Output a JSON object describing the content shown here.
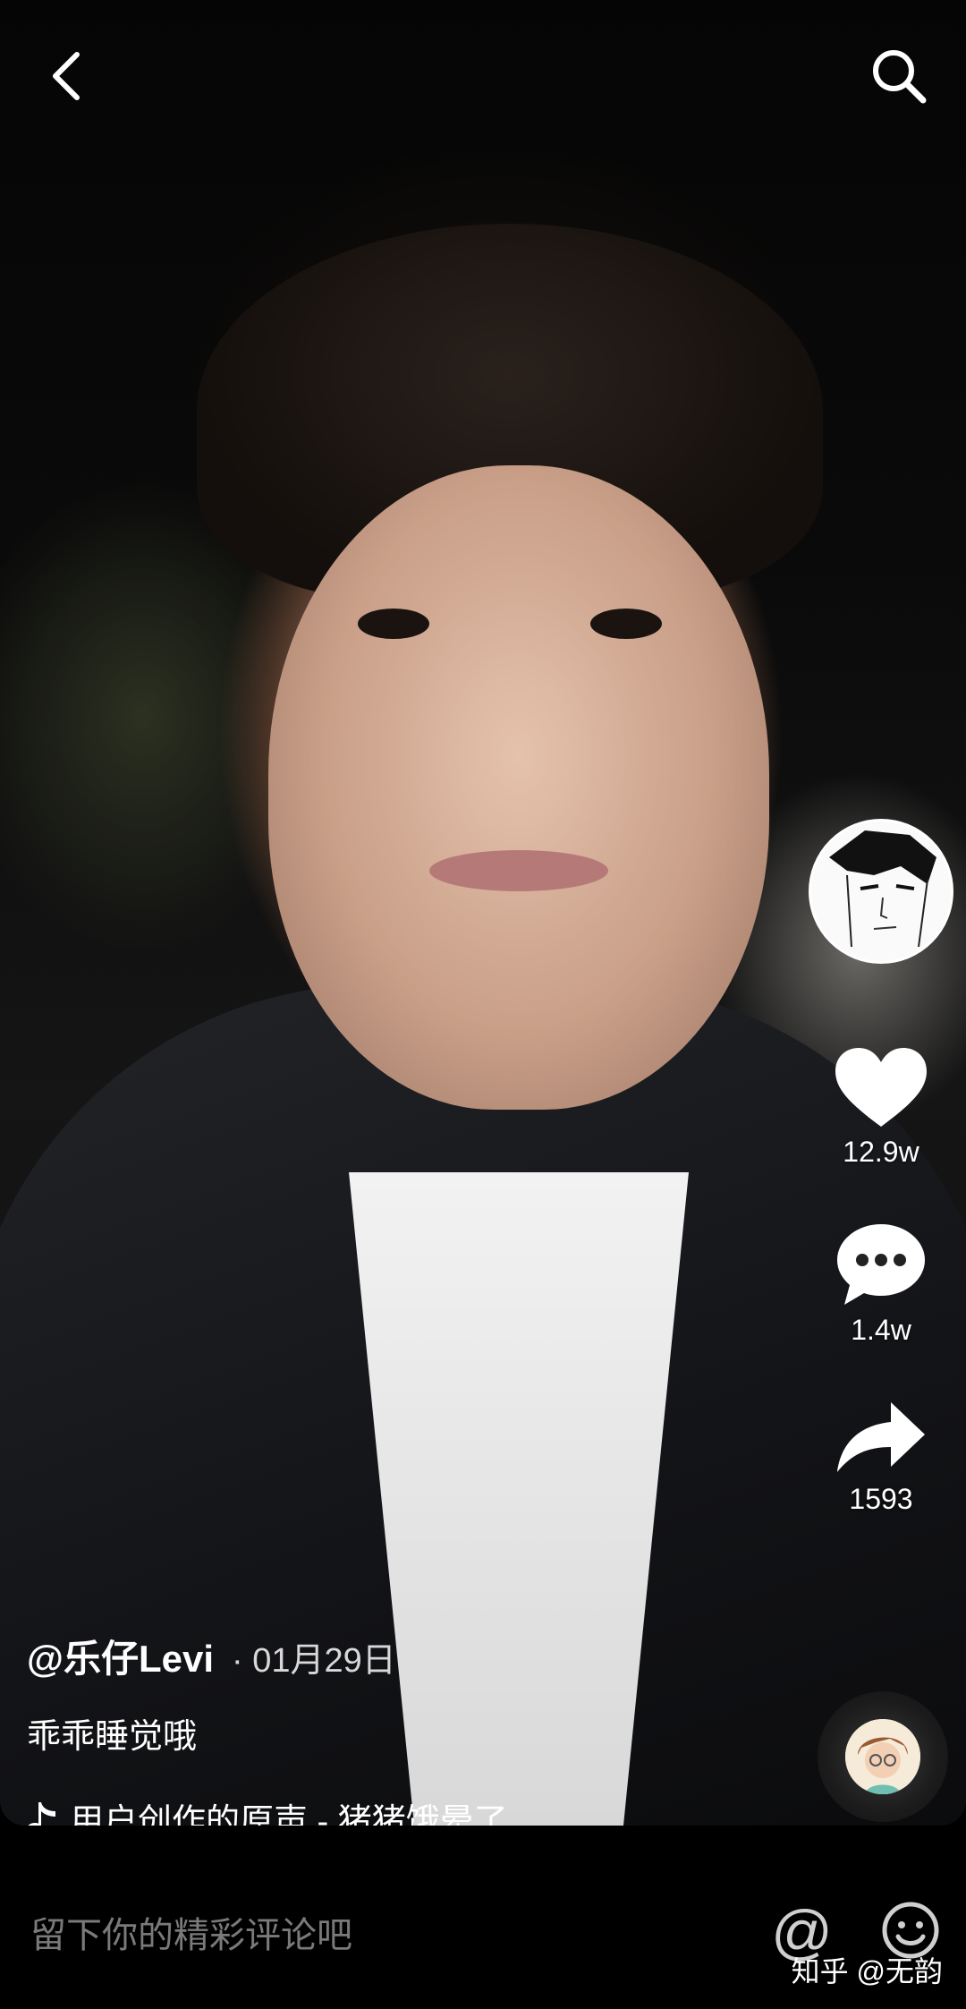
{
  "video": {
    "author": "@乐仔Levi",
    "date": "· 01月29日",
    "description": "乖乖睡觉哦",
    "music": "用户创作的原声 - 猪猪饿晕了"
  },
  "actions": {
    "likes": "12.9w",
    "comments": "1.4w",
    "shares": "1593"
  },
  "comment_bar": {
    "placeholder": "留下你的精彩评论吧",
    "at_symbol": "@"
  },
  "watermark": "知乎 @无韵",
  "icons": {
    "back": "back-chevron-icon",
    "search": "search-icon",
    "like": "heart-icon",
    "comment": "comment-bubble-icon",
    "share": "share-arrow-icon",
    "music": "music-note-icon",
    "emoji": "smiley-icon"
  }
}
